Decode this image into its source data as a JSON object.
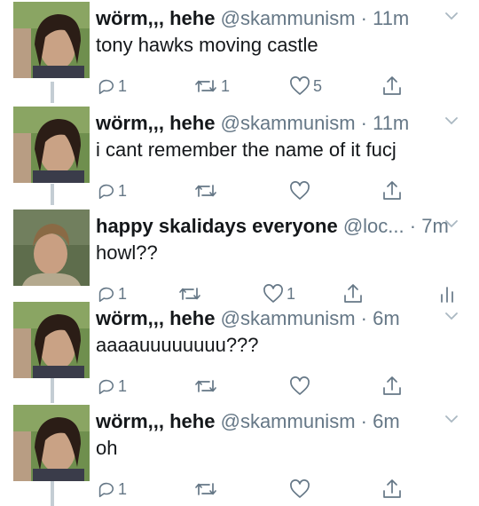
{
  "colors": {
    "text": "#14171a",
    "secondary": "#657786",
    "thread_line": "#c4cdd4"
  },
  "tweets": [
    {
      "name": "wörm,,, hehe",
      "handle": "@skammunism",
      "separator": "·",
      "time": "11m",
      "text": "tony hawks moving castle",
      "reply_count": "1",
      "retweet_count": "1",
      "like_count": "5",
      "avatar": "avatar-dark-hair-photo"
    },
    {
      "name": "wörm,,, hehe",
      "handle": "@skammunism",
      "separator": "·",
      "time": "11m",
      "text": "i cant remember the name of it fucj",
      "reply_count": "1",
      "retweet_count": "",
      "like_count": "",
      "avatar": "avatar-dark-hair-photo"
    },
    {
      "name": "happy skalidays everyone",
      "handle": "@loc...",
      "separator": "·",
      "time": "7m",
      "text": "howl??",
      "reply_count": "1",
      "retweet_count": "",
      "like_count": "1",
      "avatar": "avatar-light-hair-photo"
    },
    {
      "name": "wörm,,, hehe",
      "handle": "@skammunism",
      "separator": "·",
      "time": "6m",
      "text": "aaaauuuuuuuu???",
      "reply_count": "1",
      "retweet_count": "",
      "like_count": "",
      "avatar": "avatar-dark-hair-photo"
    },
    {
      "name": "wörm,,, hehe",
      "handle": "@skammunism",
      "separator": "·",
      "time": "6m",
      "text": "oh",
      "reply_count": "1",
      "retweet_count": "",
      "like_count": "",
      "avatar": "avatar-dark-hair-photo"
    }
  ]
}
